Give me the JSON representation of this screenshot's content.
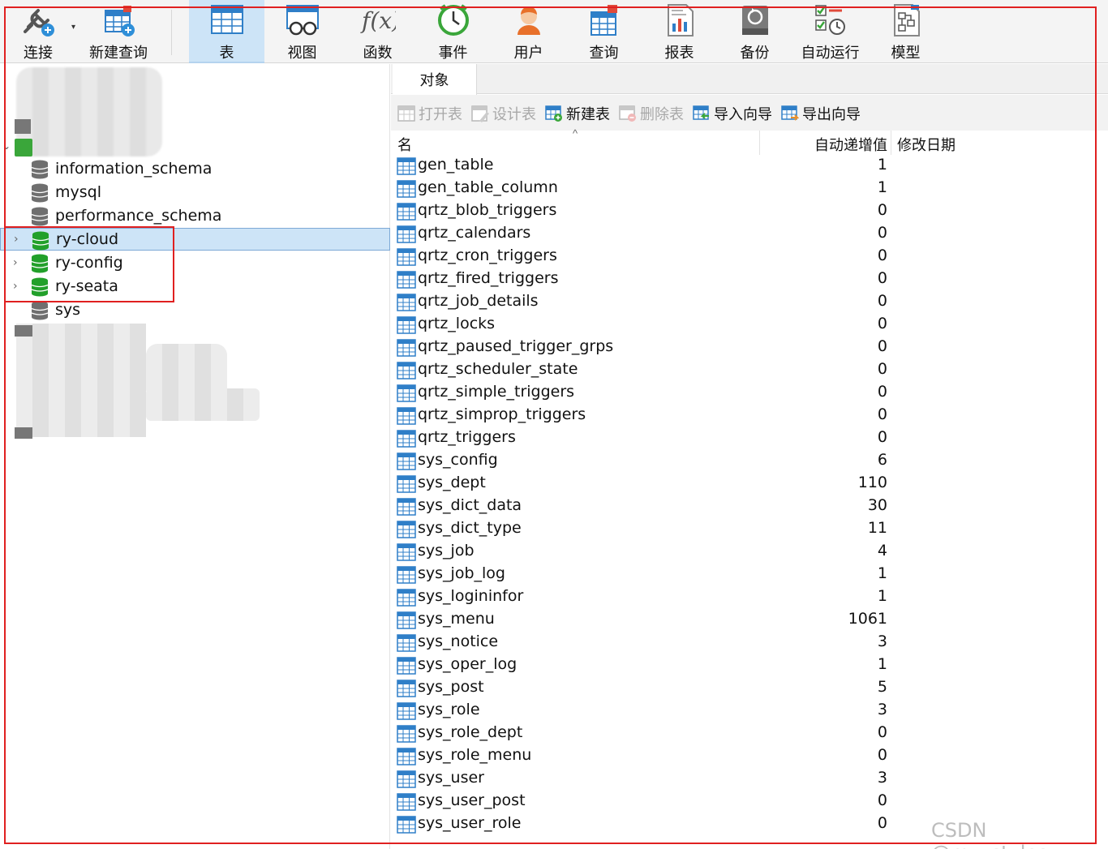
{
  "toolbar": {
    "items": [
      {
        "label": "连接",
        "icon": "plug-connect-icon"
      },
      {
        "label": "新建查询",
        "icon": "new-query-icon"
      },
      {
        "label": "表",
        "icon": "table-icon",
        "active": true
      },
      {
        "label": "视图",
        "icon": "view-glasses-icon"
      },
      {
        "label": "函数",
        "icon": "function-fx-icon"
      },
      {
        "label": "事件",
        "icon": "event-clock-icon"
      },
      {
        "label": "用户",
        "icon": "user-icon"
      },
      {
        "label": "查询",
        "icon": "query-icon"
      },
      {
        "label": "报表",
        "icon": "report-icon"
      },
      {
        "label": "备份",
        "icon": "backup-icon"
      },
      {
        "label": "自动运行",
        "icon": "auto-run-icon"
      },
      {
        "label": "模型",
        "icon": "model-icon"
      }
    ]
  },
  "tree": {
    "databases": [
      {
        "name": "information_schema",
        "active": false,
        "expandable": false
      },
      {
        "name": "mysql",
        "active": false,
        "expandable": false
      },
      {
        "name": "performance_schema",
        "active": false,
        "expandable": false
      },
      {
        "name": "ry-cloud",
        "active": true,
        "expandable": true,
        "selected": true
      },
      {
        "name": "ry-config",
        "active": true,
        "expandable": true
      },
      {
        "name": "ry-seata",
        "active": true,
        "expandable": true
      },
      {
        "name": "sys",
        "active": false,
        "expandable": false
      }
    ]
  },
  "objects_tab": {
    "label": "对象"
  },
  "subtoolbar": {
    "open_table": "打开表",
    "design_table": "设计表",
    "new_table": "新建表",
    "delete_table": "删除表",
    "import_wizard": "导入向导",
    "export_wizard": "导出向导"
  },
  "columns": {
    "name": "名",
    "auto_increment": "自动递增值",
    "modified": "修改日期"
  },
  "tables": [
    {
      "name": "gen_table",
      "ai": "1"
    },
    {
      "name": "gen_table_column",
      "ai": "1"
    },
    {
      "name": "qrtz_blob_triggers",
      "ai": "0"
    },
    {
      "name": "qrtz_calendars",
      "ai": "0"
    },
    {
      "name": "qrtz_cron_triggers",
      "ai": "0"
    },
    {
      "name": "qrtz_fired_triggers",
      "ai": "0"
    },
    {
      "name": "qrtz_job_details",
      "ai": "0"
    },
    {
      "name": "qrtz_locks",
      "ai": "0"
    },
    {
      "name": "qrtz_paused_trigger_grps",
      "ai": "0"
    },
    {
      "name": "qrtz_scheduler_state",
      "ai": "0"
    },
    {
      "name": "qrtz_simple_triggers",
      "ai": "0"
    },
    {
      "name": "qrtz_simprop_triggers",
      "ai": "0"
    },
    {
      "name": "qrtz_triggers",
      "ai": "0"
    },
    {
      "name": "sys_config",
      "ai": "6"
    },
    {
      "name": "sys_dept",
      "ai": "110"
    },
    {
      "name": "sys_dict_data",
      "ai": "30"
    },
    {
      "name": "sys_dict_type",
      "ai": "11"
    },
    {
      "name": "sys_job",
      "ai": "4"
    },
    {
      "name": "sys_job_log",
      "ai": "1"
    },
    {
      "name": "sys_logininfor",
      "ai": "1"
    },
    {
      "name": "sys_menu",
      "ai": "1061"
    },
    {
      "name": "sys_notice",
      "ai": "3"
    },
    {
      "name": "sys_oper_log",
      "ai": "1"
    },
    {
      "name": "sys_post",
      "ai": "5"
    },
    {
      "name": "sys_role",
      "ai": "3"
    },
    {
      "name": "sys_role_dept",
      "ai": "0"
    },
    {
      "name": "sys_role_menu",
      "ai": "0"
    },
    {
      "name": "sys_user",
      "ai": "3"
    },
    {
      "name": "sys_user_post",
      "ai": "0"
    },
    {
      "name": "sys_user_role",
      "ai": "0"
    }
  ],
  "watermark": "CSDN @my_styles",
  "colors": {
    "accent": "#cde4f7",
    "annotation": "#e02020",
    "db_active": "#22a02a",
    "db_inactive": "#6f6f6f"
  }
}
